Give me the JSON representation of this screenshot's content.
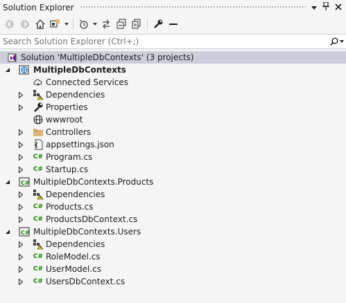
{
  "panel": {
    "title": "Solution Explorer"
  },
  "toolbar": {
    "buttons": [
      "back-icon",
      "forward-icon",
      "home-icon",
      "switch-views-icon",
      "pending-changes-icon",
      "sync-icon",
      "collapse-all-icon",
      "show-all-files-icon",
      "properties-icon",
      "preview-icon"
    ]
  },
  "search": {
    "placeholder": "Search Solution Explorer (Ctrl+;)"
  },
  "tree": {
    "solution": "Solution 'MultipleDbContexts' (3 projects)",
    "project1": {
      "name": "MultipleDbContexts",
      "items": [
        "Connected Services",
        "Dependencies",
        "Properties",
        "wwwroot",
        "Controllers",
        "appsettings.json",
        "Program.cs",
        "Startup.cs"
      ]
    },
    "project2": {
      "name": "MultipleDbContexts.Products",
      "items": [
        "Dependencies",
        "Products.cs",
        "ProductsDbContext.cs"
      ]
    },
    "project3": {
      "name": "MultipleDbContexts.Users",
      "items": [
        "Dependencies",
        "RoleModel.cs",
        "UserModel.cs",
        "UsersDbContext.cs"
      ]
    }
  },
  "colors": {
    "selection": "#cccedb",
    "csharp": "#178600",
    "folder": "#dcb67a",
    "accent": "#68217a"
  }
}
